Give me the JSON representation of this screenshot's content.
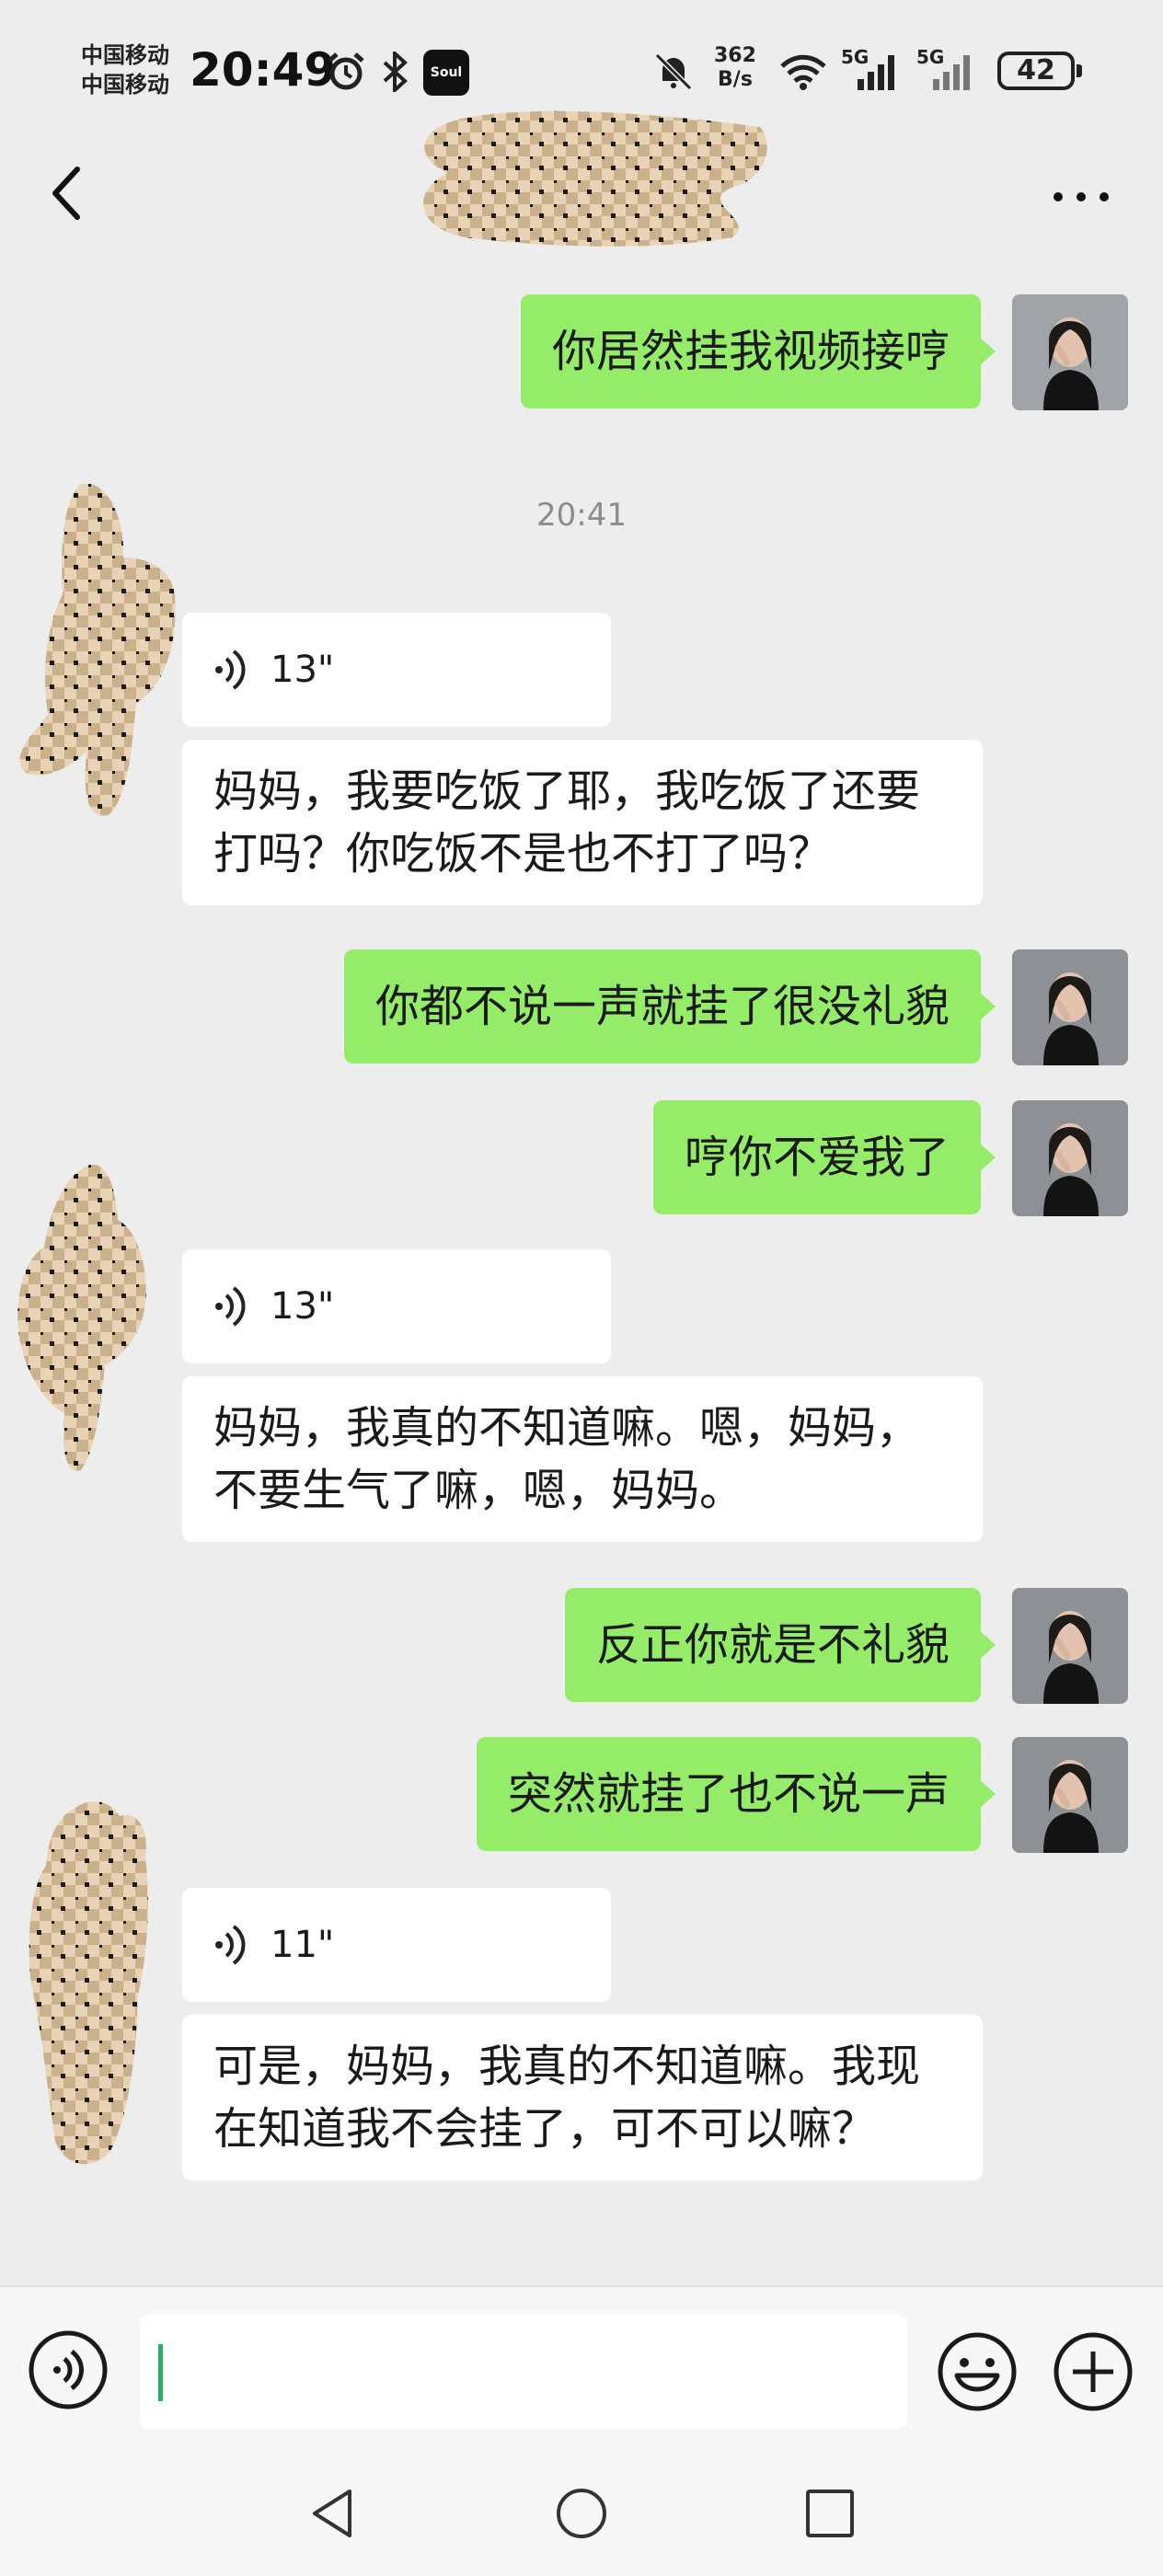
{
  "status_bar": {
    "carrier_1": "中国移动",
    "carrier_2": "中国移动",
    "time": "20:49",
    "net_speed_value": "362",
    "net_speed_unit": "B/s",
    "sim1_type": "5G",
    "sim2_type": "5G",
    "battery": "42",
    "app_badge": "Soul"
  },
  "header": {
    "title": ""
  },
  "messages": {
    "m1": "你居然挂我视频接哼",
    "timestamp": "20:41",
    "v1_duration": "13\"",
    "v1_text": "妈妈，我要吃饭了耶，我吃饭了还要打吗？你吃饭不是也不打了吗？",
    "m2": "你都不说一声就挂了很没礼貌",
    "m3": "哼你不爱我了",
    "v2_duration": "13\"",
    "v2_text": "妈妈，我真的不知道嘛。嗯，妈妈，不要生气了嘛，嗯，妈妈。",
    "m4": "反正你就是不礼貌",
    "m5": "突然就挂了也不说一声",
    "v3_duration": "11\"",
    "v3_text": "可是，妈妈，我真的不知道嘛。我现在知道我不会挂了，可不可以嘛？"
  },
  "input_bar": {
    "value": ""
  },
  "colors": {
    "background": "#ededed",
    "outgoing_bubble": "#95ec69",
    "incoming_bubble": "#ffffff",
    "cursor": "#2aae67"
  }
}
